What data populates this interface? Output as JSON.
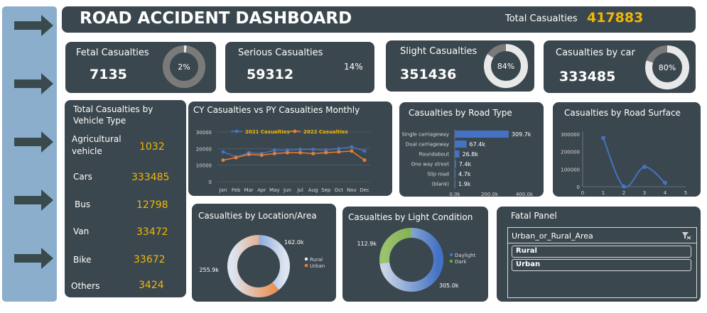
{
  "header": {
    "title": "ROAD ACCIDENT DASHBOARD",
    "total_label": "Total Casualties",
    "total_value": "417883"
  },
  "kpis": {
    "fatal": {
      "label": "Fetal Casualties",
      "value": "7135",
      "pct_label": "2%",
      "pct": 0.02
    },
    "serious": {
      "label": "Serious Casualties",
      "value": "59312",
      "pct_label": "14%",
      "pct": 0.14
    },
    "slight": {
      "label": "Slight Casualties",
      "value": "351436",
      "pct_label": "84%",
      "pct": 0.84
    },
    "car": {
      "label": "Casualties by car",
      "value": "333485",
      "pct_label": "80%",
      "pct": 0.8
    }
  },
  "vehicle_panel": {
    "title_line1": "Total Casualties by",
    "title_line2": "Vehicle Type",
    "items": [
      {
        "label1": "Agricultural",
        "label2": "vehicle",
        "value": "1032"
      },
      {
        "label1": "Cars",
        "label2": "",
        "value": "333485"
      },
      {
        "label1": "Bus",
        "label2": "",
        "value": "12798"
      },
      {
        "label1": "Van",
        "label2": "",
        "value": "33472"
      },
      {
        "label1": "Bike",
        "label2": "",
        "value": "33672"
      },
      {
        "label1": "Others",
        "label2": "",
        "value": "3424"
      }
    ]
  },
  "fatal_panel": {
    "title": "Fatal Panel",
    "slicer_header": "Urban_or_Rural_Area",
    "options": [
      "Rural",
      "Urban"
    ]
  },
  "colors": {
    "accent_blue": "#4472c4",
    "accent_orange": "#ed7d31",
    "gold": "#f2b705",
    "panel": "#3b474e",
    "sidebar": "#8aaecb"
  },
  "chart_data": [
    {
      "type": "line",
      "title": "CY Casualties vs PY Casualties Monthly",
      "categories": [
        "Jan",
        "Feb",
        "Mar",
        "Apr",
        "May",
        "Jun",
        "Jul",
        "Aug",
        "Sep",
        "Oct",
        "Nov",
        "Dec"
      ],
      "series": [
        {
          "name": "2021 Casualties",
          "values": [
            18000,
            15000,
            17500,
            17000,
            19000,
            19000,
            19500,
            19500,
            19000,
            20000,
            21000,
            18500
          ]
        },
        {
          "name": "2022 Casualties",
          "values": [
            13000,
            14500,
            16500,
            16000,
            17000,
            17500,
            17500,
            17000,
            17500,
            18000,
            18500,
            13000
          ]
        }
      ],
      "yticks": [
        "0",
        "10000",
        "20000",
        "30000"
      ],
      "ylim": [
        0,
        30000
      ],
      "legend": "top"
    },
    {
      "type": "bar",
      "orientation": "horizontal",
      "title": "Casualties by Road Type",
      "categories": [
        "Single carriageway",
        "Dual carriageway",
        "Roundabout",
        "One way street",
        "Slip road",
        "(blank)"
      ],
      "values": [
        309700,
        67400,
        26800,
        7400,
        4700,
        1900
      ],
      "value_labels": [
        "309.7k",
        "67.4k",
        "26.8k",
        "7.4k",
        "4.7k",
        "1.9k"
      ],
      "xticks": [
        "0.0k",
        "200.0k",
        "400.0k"
      ],
      "xlim": [
        0,
        400000
      ]
    },
    {
      "type": "line",
      "title": "Casualties by Road Surface",
      "x": [
        1,
        2,
        3,
        4
      ],
      "y": [
        278000,
        1000,
        113000,
        22000
      ],
      "xticks": [
        "0",
        "1",
        "2",
        "3",
        "4",
        "5"
      ],
      "yticks": [
        "0",
        "100000",
        "200000",
        "300000"
      ],
      "xlim": [
        0,
        5
      ],
      "ylim": [
        0,
        300000
      ]
    },
    {
      "type": "pie",
      "style": "donut",
      "title": "Casualties by Location/Area",
      "slices": [
        {
          "name": "Rural",
          "value": 162000,
          "label": "162.0k"
        },
        {
          "name": "Urban",
          "value": 255900,
          "label": "255.9k"
        }
      ],
      "legend": "right"
    },
    {
      "type": "pie",
      "style": "donut",
      "title": "Casualties by Light Condition",
      "slices": [
        {
          "name": "Daylight",
          "value": 305000,
          "label": "305.0k"
        },
        {
          "name": "Dark",
          "value": 112900,
          "label": "112.9k"
        }
      ],
      "legend": "right"
    }
  ]
}
